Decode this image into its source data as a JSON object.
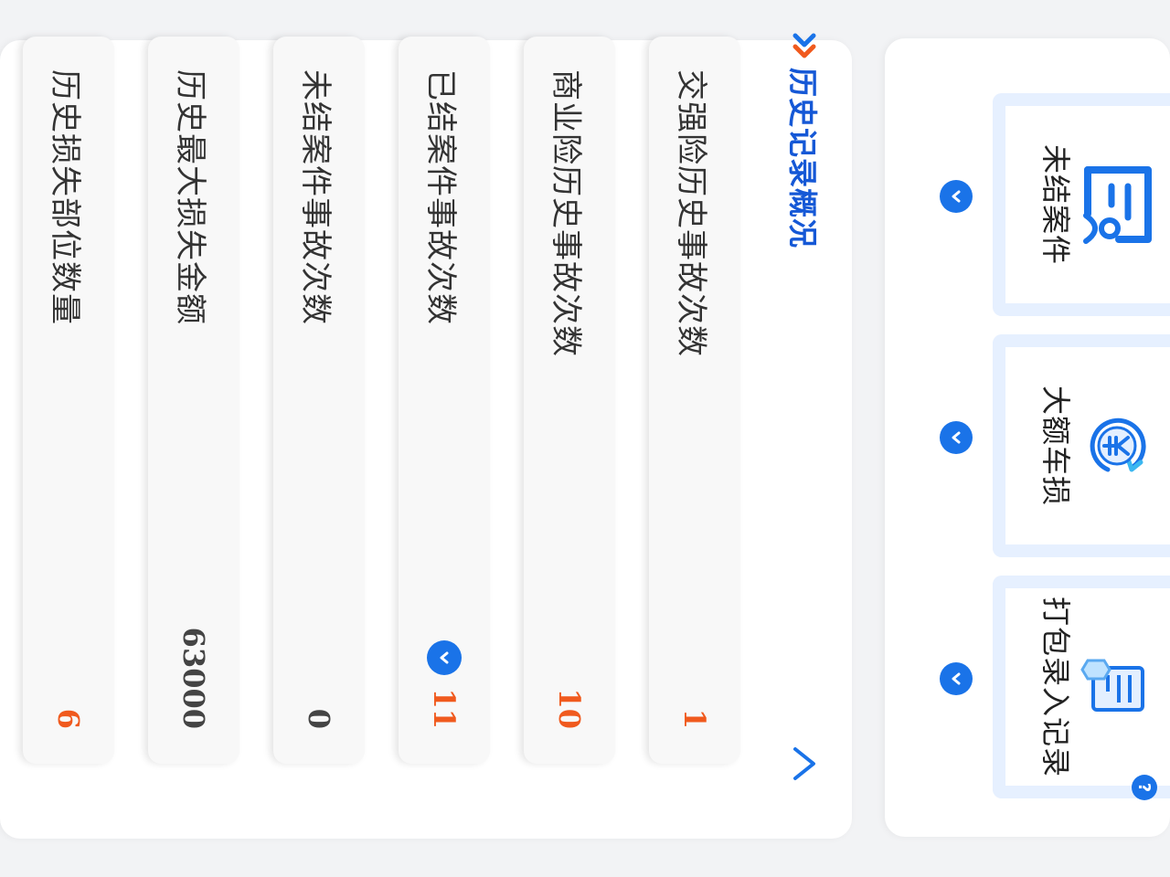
{
  "actions": {
    "tiles": [
      {
        "label": "未结案件",
        "icon": "case-user-icon"
      },
      {
        "label": "大额车损",
        "icon": "yen-refresh-icon"
      },
      {
        "label": "打包录入记录",
        "icon": "package-document-icon",
        "badge": "?"
      }
    ]
  },
  "history": {
    "title": "历史记录概况",
    "rows": [
      {
        "label": "交强险历史事故次数",
        "value": "1"
      },
      {
        "label": "商业险历史事故次数",
        "value": "10"
      },
      {
        "label": "已结案件事故次数",
        "value": "11"
      },
      {
        "label": "未结案件事故次数",
        "value": "0"
      },
      {
        "label": "历史最大损失金额",
        "value": "63000"
      },
      {
        "label": "历史损失部位数量",
        "value": "6"
      }
    ]
  },
  "colors": {
    "accent": "#1a73e8",
    "title": "#1558d6",
    "value_highlight": "#f05a1e",
    "tile_border": "#e6f0ff"
  }
}
